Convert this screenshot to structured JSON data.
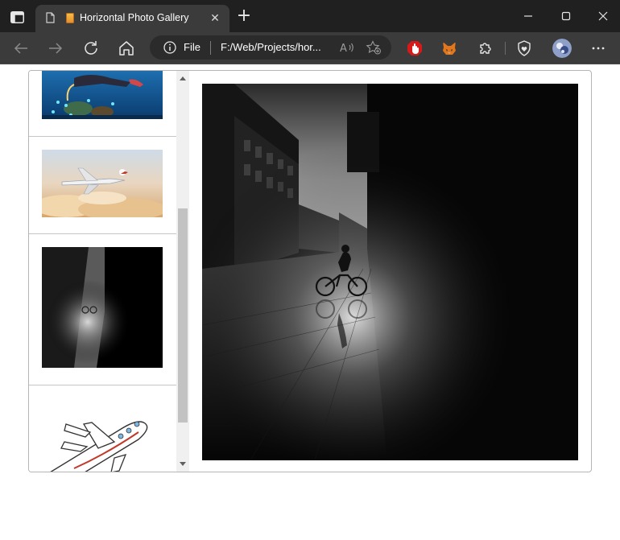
{
  "browser": {
    "tab_title": "Horizontal Photo Gallery",
    "address_scheme": "File",
    "address_url": "F:/Web/Projects/hor...",
    "icons": {
      "tab_actions": "tab-actions-icon",
      "page": "page-icon",
      "tab_close": "close-icon",
      "new_tab": "plus-icon",
      "minimize": "minimize-icon",
      "maximize": "maximize-icon",
      "close": "close-icon",
      "back": "back-arrow-icon",
      "forward": "forward-arrow-icon",
      "refresh": "refresh-icon",
      "home": "home-icon",
      "site_info": "info-icon",
      "read_aloud": "read-aloud-icon",
      "add_favorite": "add-favorite-icon",
      "extensions": "puzzle-icon",
      "browser_essentials": "shield-heart-icon",
      "menu": "ellipsis-icon"
    }
  },
  "gallery": {
    "thumbnails": [
      {
        "subject": "underwater-scuba-diver"
      },
      {
        "subject": "airplane-above-clouds"
      },
      {
        "subject": "cyclist-dark-street"
      },
      {
        "subject": "cartoon-airplane"
      }
    ],
    "selected_image": "cyclist-dark-street",
    "scroll_position": 0.57
  },
  "colors": {
    "tabbar": "#202020",
    "toolbar": "#3b3b3b",
    "gallery_border": "#b5b5b5",
    "scroll_thumb": "#c2c2c2"
  }
}
